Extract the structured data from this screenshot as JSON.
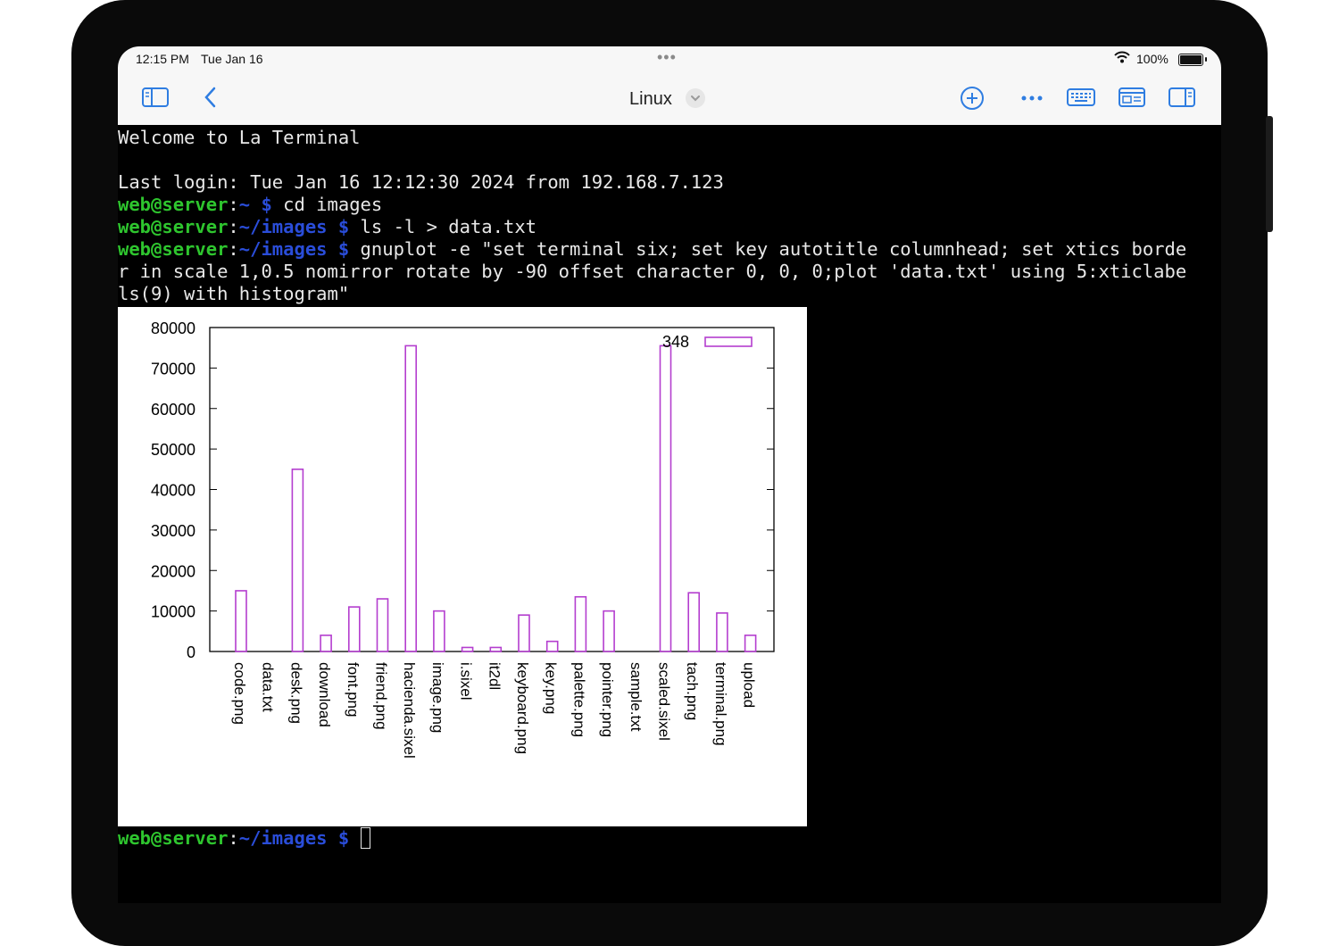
{
  "status_bar": {
    "time": "12:15 PM",
    "date": "Tue Jan 16",
    "battery": "100%"
  },
  "toolbar": {
    "title": "Linux",
    "icons": [
      "sidebar-icon",
      "back-chevron-icon",
      "add-circle-icon",
      "more-icon",
      "keyboard-icon",
      "window-icon",
      "inspector-icon"
    ]
  },
  "terminal": {
    "welcome": "Welcome to La Terminal",
    "last_login": "Last login: Tue Jan 16 12:12:30 2024 from 192.168.7.123",
    "prompt_user": "web@server",
    "prompt_sep": ":",
    "prompt_home": "~",
    "prompt_images": "~/images",
    "prompt_dollar": "$",
    "cmd1": " cd images",
    "cmd2": " ls -l > data.txt",
    "cmd3": " gnuplot -e \"set terminal six; set key autotitle columnhead; set xtics borde",
    "cmd3_cont1": "r in scale 1,0.5 nomirror rotate by -90 offset character 0, 0, 0;plot 'data.txt' using 5:xticlabe",
    "cmd3_cont2": "ls(9) with histogram\""
  },
  "chart_data": {
    "type": "bar",
    "style": "histogram-outline",
    "bar_color": "#b43ecf",
    "legend": {
      "label": "348",
      "position": "top-right"
    },
    "categories": [
      "code.png",
      "data.txt",
      "desk.png",
      "download",
      "font.png",
      "friend.png",
      "hacienda.sixel",
      "image.png",
      "i.sixel",
      "it2dl",
      "keyboard.png",
      "key.png",
      "palette.png",
      "pointer.png",
      "sample.txt",
      "scaled.sixel",
      "tach.png",
      "terminal.png",
      "upload"
    ],
    "values": [
      15000,
      0,
      45000,
      4000,
      11000,
      13000,
      75500,
      10000,
      1000,
      1000,
      9000,
      2500,
      13500,
      10000,
      0,
      75500,
      14500,
      9500,
      4000
    ],
    "yticks": [
      "0",
      "10000",
      "20000",
      "30000",
      "40000",
      "50000",
      "60000",
      "70000",
      "80000"
    ],
    "ylim": [
      0,
      80000
    ],
    "grid": false
  }
}
